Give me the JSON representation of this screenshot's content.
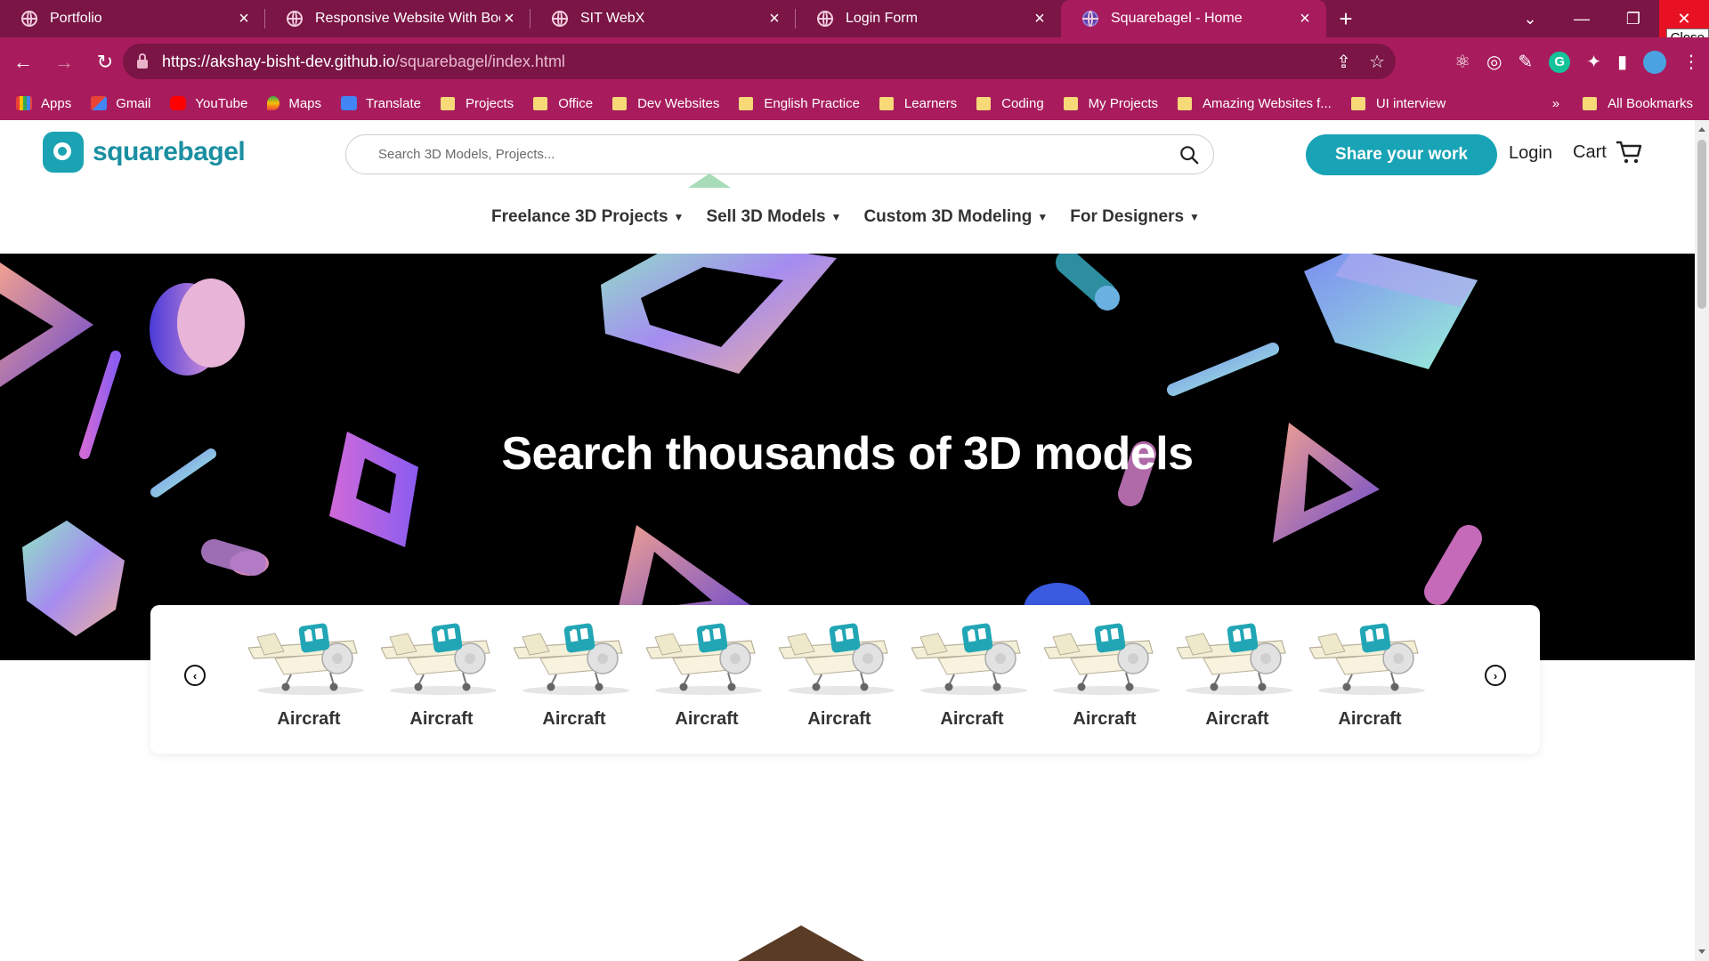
{
  "browser": {
    "tabs": [
      {
        "label": "Portfolio",
        "active": false
      },
      {
        "label": "Responsive Website With Bootst",
        "active": false
      },
      {
        "label": "SIT WebX",
        "active": false
      },
      {
        "label": "Login Form",
        "active": false
      },
      {
        "label": "Squarebagel - Home",
        "active": true
      }
    ],
    "close_tooltip": "Close",
    "url_host": "https://akshay-bisht-dev.github.io",
    "url_path": "/squarebagel/index.html",
    "bookmarks": [
      {
        "label": "Apps",
        "icon": "apps-grid-icon"
      },
      {
        "label": "Gmail",
        "icon": "gmail-icon"
      },
      {
        "label": "YouTube",
        "icon": "youtube-icon"
      },
      {
        "label": "Maps",
        "icon": "maps-icon"
      },
      {
        "label": "Translate",
        "icon": "translate-icon"
      },
      {
        "label": "Projects",
        "icon": "folder-icon"
      },
      {
        "label": "Office",
        "icon": "folder-icon"
      },
      {
        "label": "Dev Websites",
        "icon": "folder-icon"
      },
      {
        "label": "English Practice",
        "icon": "folder-icon"
      },
      {
        "label": "Learners",
        "icon": "folder-icon"
      },
      {
        "label": "Coding",
        "icon": "folder-icon"
      },
      {
        "label": "My Projects",
        "icon": "folder-icon"
      },
      {
        "label": "Amazing Websites f...",
        "icon": "folder-icon"
      },
      {
        "label": "UI interview",
        "icon": "folder-icon"
      }
    ],
    "overflow": "»",
    "all_bookmarks": "All Bookmarks",
    "colors": {
      "tabbar": "#7a1545",
      "toolbar": "#a81c5d"
    }
  },
  "site": {
    "logo_text": "squarebagel",
    "search_placeholder": "Search 3D Models, Projects...",
    "share_button": "Share your work",
    "login": "Login",
    "cart": "Cart",
    "nav": [
      {
        "label": "Freelance 3D Projects"
      },
      {
        "label": "Sell 3D Models"
      },
      {
        "label": "Custom 3D Modeling"
      },
      {
        "label": "For Designers"
      }
    ],
    "hero_title": "Search thousands of 3D models",
    "carousel": {
      "prev": "‹",
      "next": "›",
      "items": [
        {
          "label": "Aircraft"
        },
        {
          "label": "Aircraft"
        },
        {
          "label": "Aircraft"
        },
        {
          "label": "Aircraft"
        },
        {
          "label": "Aircraft"
        },
        {
          "label": "Aircraft"
        },
        {
          "label": "Aircraft"
        },
        {
          "label": "Aircraft"
        },
        {
          "label": "Aircraft"
        }
      ]
    },
    "colors": {
      "brand": "#18a3b6",
      "hero_bg": "#000000"
    }
  }
}
